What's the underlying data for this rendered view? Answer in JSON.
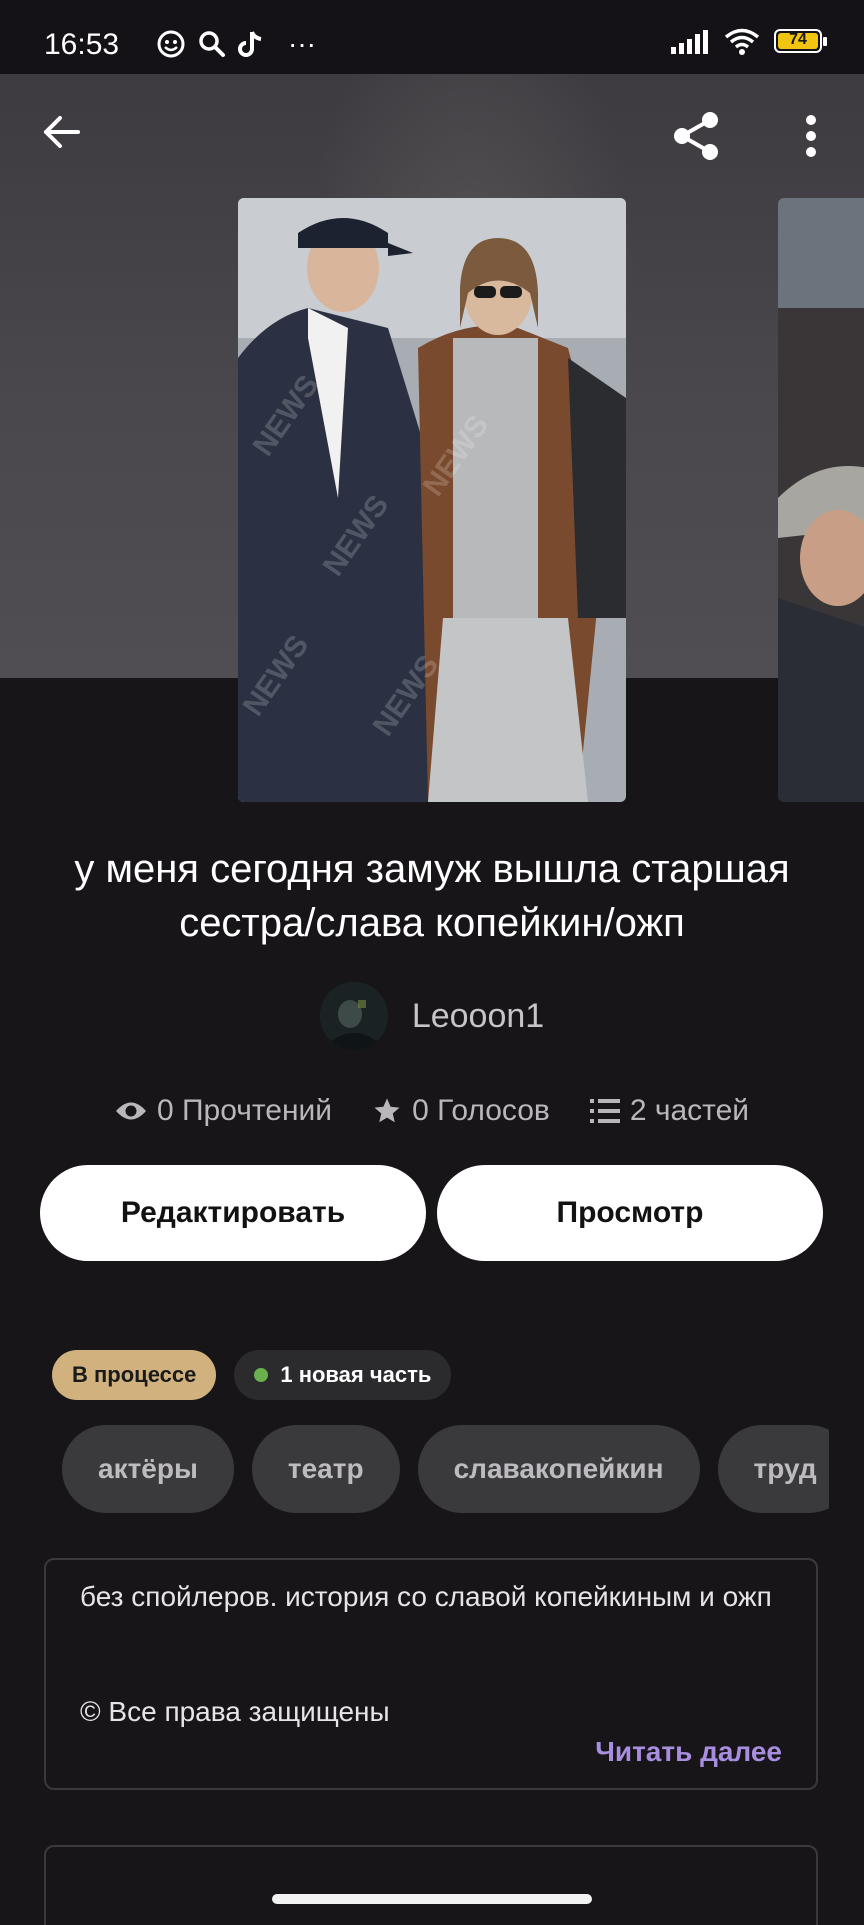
{
  "status_bar": {
    "time": "16:53",
    "more": "···",
    "battery": "74"
  },
  "top_bar": {
    "back_icon": "arrow-left",
    "share_icon": "share",
    "menu_icon": "more-vertical"
  },
  "story": {
    "title": "у меня сегодня замуж вышла старшая сестра/слава копейкин/ожп",
    "author": "Leooon1",
    "stats": {
      "reads": "0 Прочтений",
      "votes": "0 Голосов",
      "parts": "2 частей"
    }
  },
  "actions": {
    "edit": "Редактировать",
    "preview": "Просмотр"
  },
  "badges": {
    "status": "В процессе",
    "new_part": "1 новая часть"
  },
  "tags": [
    "актёры",
    "театр",
    "славакопейкин",
    "труд"
  ],
  "description": {
    "text": "без спойлеров. история со славой копейкиным и ожп",
    "copyright": "© Все права защищены",
    "read_more": "Читать далее"
  },
  "colors": {
    "background": "#171518",
    "badge_progress": "#d1b27e",
    "read_more": "#a98ee0",
    "new_dot": "#6ab04c"
  }
}
